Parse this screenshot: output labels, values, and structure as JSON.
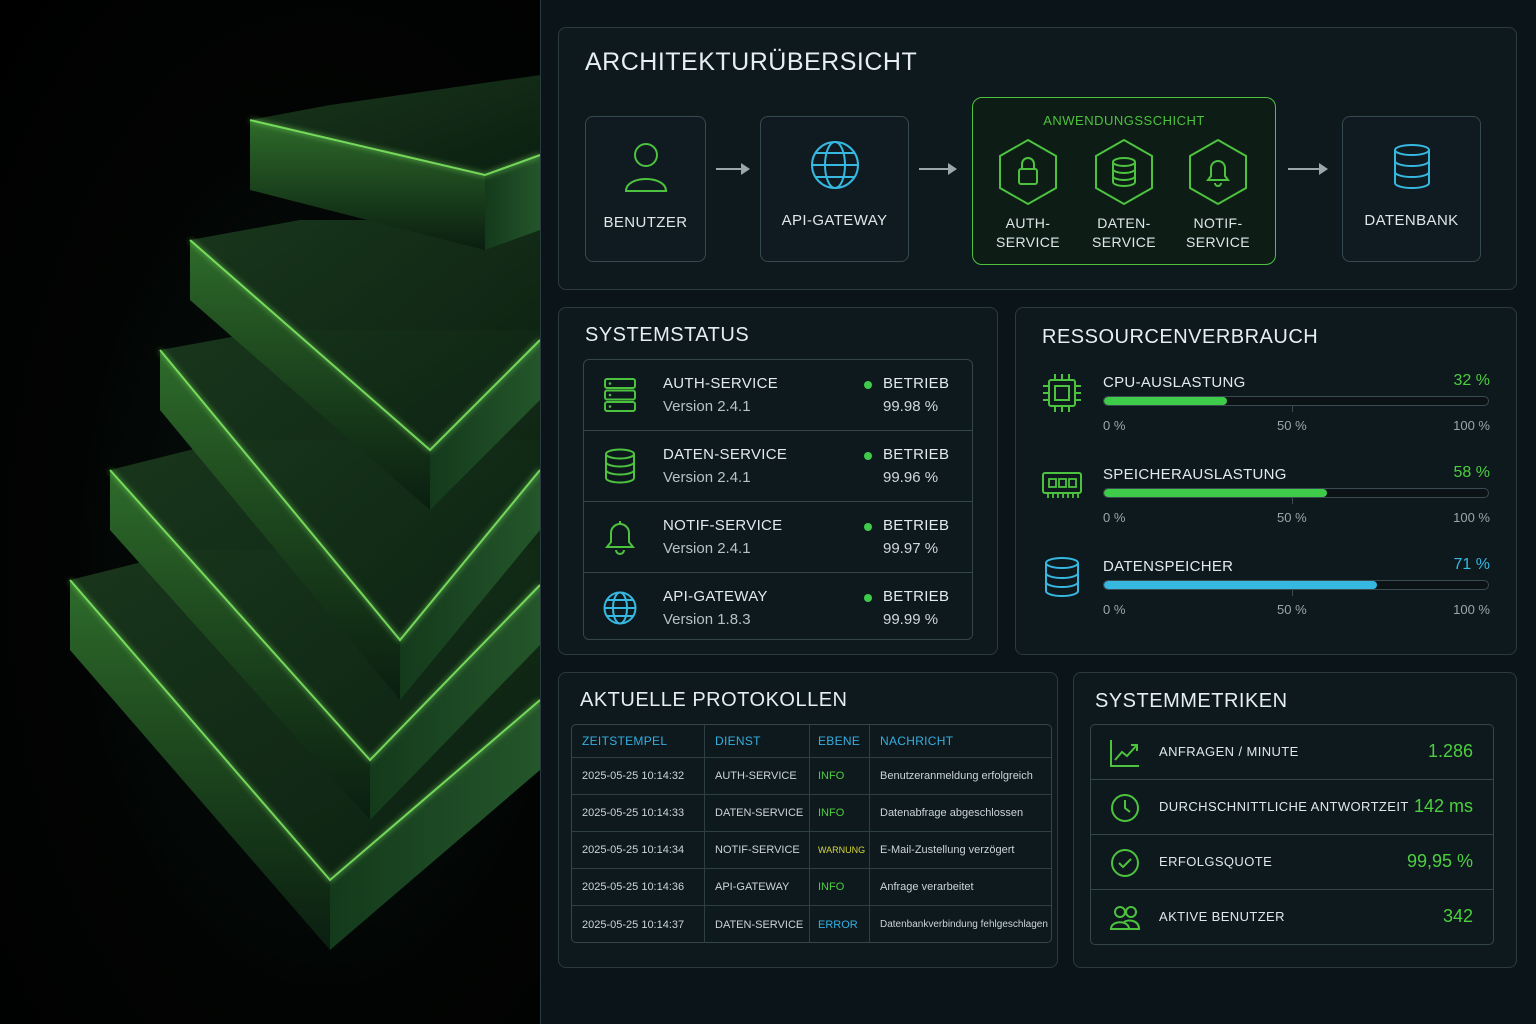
{
  "architecture": {
    "title": "ARCHITEKTURÜBERSICHT",
    "nodes": {
      "user": "BENUTZER",
      "gateway": "API-GATEWAY",
      "database": "DATENBANK"
    },
    "app_layer": {
      "title": "ANWENDUNGSSCHICHT",
      "services": [
        {
          "line1": "AUTH-",
          "line2": "SERVICE",
          "icon": "lock-icon"
        },
        {
          "line1": "DATEN-",
          "line2": "SERVICE",
          "icon": "database-icon"
        },
        {
          "line1": "NOTIF-",
          "line2": "SERVICE",
          "icon": "bell-icon"
        }
      ]
    }
  },
  "system_status": {
    "title": "SYSTEMSTATUS",
    "rows": [
      {
        "name": "AUTH-SERVICE",
        "version": "Version 2.4.1",
        "status": "BETRIEB",
        "uptime": "99.98 %",
        "icon": "server-icon"
      },
      {
        "name": "DATEN-SERVICE",
        "version": "Version 2.4.1",
        "status": "BETRIEB",
        "uptime": "99.96 %",
        "icon": "database-icon"
      },
      {
        "name": "NOTIF-SERVICE",
        "version": "Version 2.4.1",
        "status": "BETRIEB",
        "uptime": "99.97 %",
        "icon": "bell-icon"
      },
      {
        "name": "API-GATEWAY",
        "version": "Version 1.8.3",
        "status": "BETRIEB",
        "uptime": "99.99 %",
        "icon": "globe-icon"
      }
    ]
  },
  "resources": {
    "title": "RESSOURCENVERBRAUCH",
    "scale": [
      "0 %",
      "50 %",
      "100 %"
    ],
    "items": [
      {
        "name": "CPU-AUSLASTUNG",
        "percent_label": "32 %",
        "value": 32,
        "color": "#3ecb4a",
        "icon": "cpu-icon"
      },
      {
        "name": "SPEICHERAUSLASTUNG",
        "percent_label": "58 %",
        "value": 58,
        "color": "#3ecb4a",
        "icon": "memory-icon"
      },
      {
        "name": "DATENSPEICHER",
        "percent_label": "71 %",
        "value": 71,
        "color": "#36b8e0",
        "icon": "storage-icon"
      }
    ]
  },
  "logs": {
    "title": "AKTUELLE PROTOKOLLEN",
    "columns": [
      "ZEITSTEMPEL",
      "DIENST",
      "EBENE",
      "NACHRICHT"
    ],
    "rows": [
      {
        "time": "2025-05-25 10:14:32",
        "service": "AUTH-SERVICE",
        "level": "INFO",
        "message": "Benutzeranmeldung erfolgreich"
      },
      {
        "time": "2025-05-25 10:14:33",
        "service": "DATEN-SERVICE",
        "level": "INFO",
        "message": "Datenabfrage abgeschlossen"
      },
      {
        "time": "2025-05-25 10:14:34",
        "service": "NOTIF-SERVICE",
        "level": "WARNUNG",
        "message": "E-Mail-Zustellung verzögert"
      },
      {
        "time": "2025-05-25 10:14:36",
        "service": "API-GATEWAY",
        "level": "INFO",
        "message": "Anfrage verarbeitet"
      },
      {
        "time": "2025-05-25 10:14:37",
        "service": "DATEN-SERVICE",
        "level": "ERROR",
        "message": "Datenbankverbindung fehlgeschlagen"
      }
    ],
    "level_colors": {
      "INFO": "#4ccf3e",
      "WARNUNG": "#d6d63a",
      "ERROR": "#36aee0"
    }
  },
  "metrics": {
    "title": "SYSTEMMETRIKEN",
    "rows": [
      {
        "name": "ANFRAGEN / MINUTE",
        "value": "1.286",
        "icon": "trend-icon"
      },
      {
        "name": "DURCHSCHNITTLICHE ANTWORTZEIT",
        "value": "142 ms",
        "icon": "clock-icon"
      },
      {
        "name": "ERFOLGSQUOTE",
        "value": "99,95 %",
        "icon": "check-circle-icon"
      },
      {
        "name": "AKTIVE BENUTZER",
        "value": "342",
        "icon": "users-icon"
      }
    ]
  }
}
